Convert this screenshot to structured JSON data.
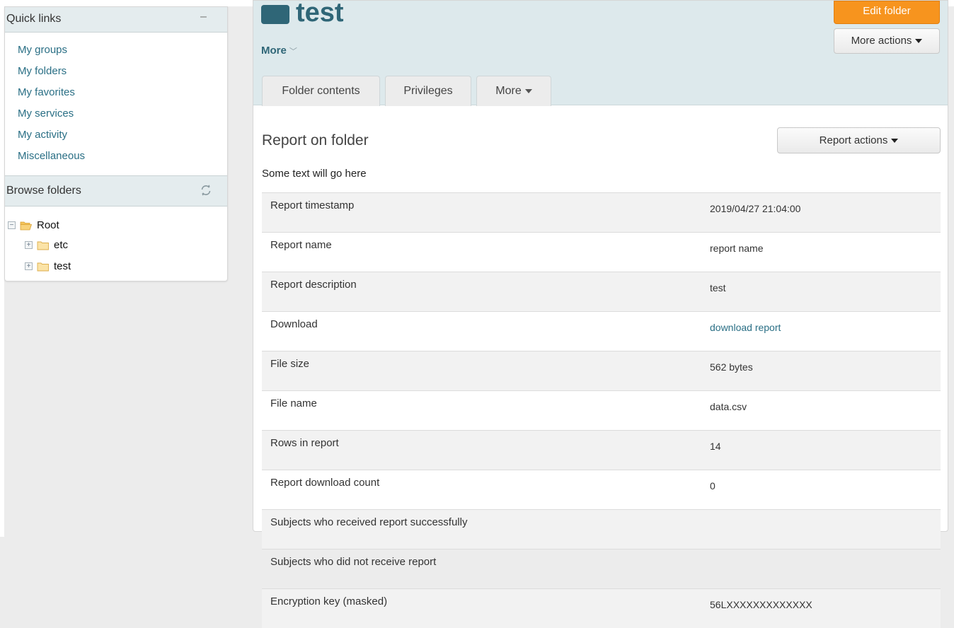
{
  "sidebar": {
    "quick_links": {
      "title": "Quick links",
      "collapse": "–",
      "items": [
        "My groups",
        "My folders",
        "My favorites",
        "My services",
        "My activity",
        "Miscellaneous"
      ]
    },
    "browse": {
      "title": "Browse folders",
      "tree": {
        "root": "Root",
        "children": [
          "etc",
          "test"
        ]
      }
    }
  },
  "header": {
    "title": "test",
    "more": "More",
    "edit_button": "Edit folder",
    "more_actions": "More actions",
    "tabs": [
      "Folder contents",
      "Privileges",
      "More"
    ]
  },
  "report": {
    "heading": "Report on folder",
    "actions_button": "Report actions",
    "intro": "Some text will go here",
    "rows": [
      {
        "label": "Report timestamp",
        "value": "2019/04/27 21:04:00"
      },
      {
        "label": "Report name",
        "value": "report name"
      },
      {
        "label": "Report description",
        "value": "test"
      },
      {
        "label": "Download",
        "value": "download report"
      },
      {
        "label": "File size",
        "value": "562 bytes"
      },
      {
        "label": "File name",
        "value": "data.csv"
      },
      {
        "label": "Rows in report",
        "value": "14"
      },
      {
        "label": "Report download count",
        "value": "0"
      },
      {
        "label": "Subjects who received report successfully",
        "value": ""
      },
      {
        "label": "Subjects who did not receive report",
        "value": ""
      },
      {
        "label": "Encryption key (masked)",
        "value": "56LXXXXXXXXXXXXX"
      }
    ]
  },
  "colors": {
    "brand": "#2f6677",
    "link": "#2a6f85",
    "accent_button": "#f7941e",
    "header_bg": "#dde9ec"
  },
  "icons": [
    "collapse-icon",
    "refresh-icon",
    "tree-toggle-icon",
    "folder-open-icon",
    "folder-icon",
    "caret-down-icon",
    "chevron-down-icon"
  ]
}
